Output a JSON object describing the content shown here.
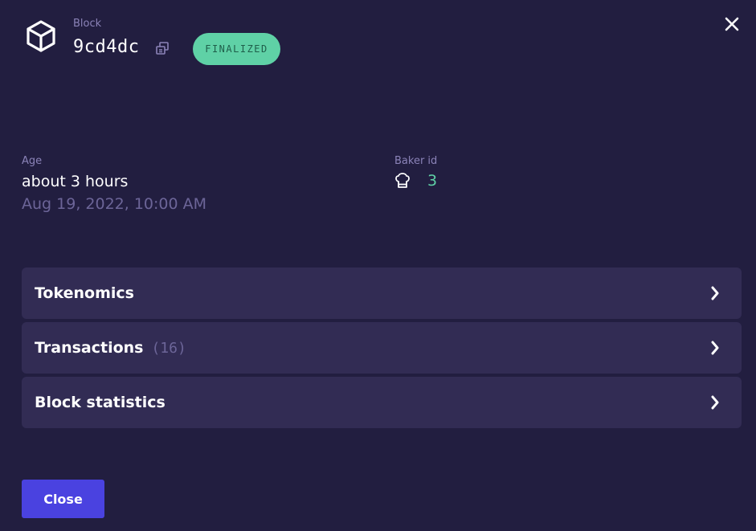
{
  "header": {
    "type_label": "Block",
    "hash": "9cd4dc",
    "status": "FINALIZED",
    "icons": {
      "block": "cube-icon",
      "copy": "copy-icon",
      "close": "close-icon"
    }
  },
  "details": {
    "age": {
      "label": "Age",
      "relative": "about 3 hours",
      "timestamp": "Aug 19, 2022, 10:00 AM"
    },
    "baker": {
      "label": "Baker id",
      "icon": "chef-hat-icon",
      "id": "3"
    }
  },
  "sections": [
    {
      "title": "Tokenomics",
      "count": ""
    },
    {
      "title": "Transactions",
      "count": "(16)"
    },
    {
      "title": "Block statistics",
      "count": ""
    }
  ],
  "footer": {
    "close_label": "Close"
  },
  "colors": {
    "background": "#221e40",
    "panel": "#322c54",
    "accent": "#4a42e0",
    "success": "#5fd1a6",
    "muted": "#8b83b8"
  }
}
